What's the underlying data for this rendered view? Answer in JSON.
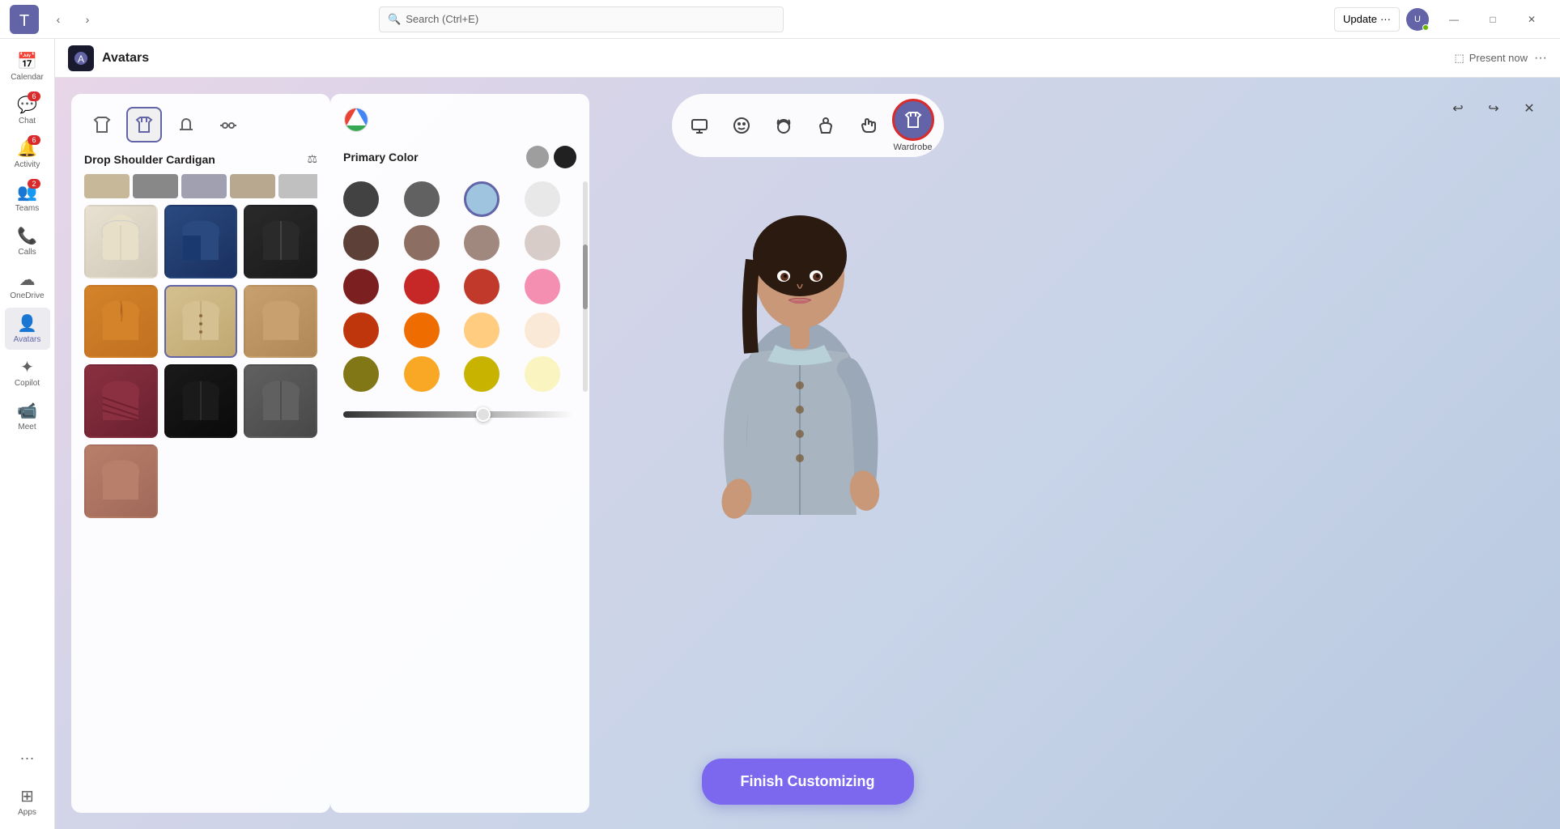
{
  "titlebar": {
    "search_placeholder": "Search (Ctrl+E)",
    "update_label": "Update",
    "update_dots": "···",
    "minimize": "—",
    "maximize": "□",
    "close": "✕"
  },
  "sidebar": {
    "items": [
      {
        "id": "calendar",
        "label": "Calendar",
        "icon": "📅",
        "badge": null
      },
      {
        "id": "chat",
        "label": "Chat",
        "icon": "💬",
        "badge": "6"
      },
      {
        "id": "activity",
        "label": "Activity",
        "icon": "🔔",
        "badge": "6"
      },
      {
        "id": "teams",
        "label": "Teams",
        "icon": "👥",
        "badge": "2"
      },
      {
        "id": "calls",
        "label": "Calls",
        "icon": "📞",
        "badge": null
      },
      {
        "id": "onedrive",
        "label": "OneDrive",
        "icon": "☁",
        "badge": null
      },
      {
        "id": "avatars",
        "label": "Avatars",
        "icon": "👤",
        "badge": null,
        "active": true
      },
      {
        "id": "copilot",
        "label": "Copilot",
        "icon": "✦",
        "badge": null
      },
      {
        "id": "meet",
        "label": "Meet",
        "icon": "📹",
        "badge": null
      },
      {
        "id": "apps",
        "label": "Apps",
        "icon": "⊞",
        "badge": null
      }
    ]
  },
  "app": {
    "title": "Avatars",
    "present_now_label": "Present now",
    "more_options": "···"
  },
  "toolbar": {
    "buttons": [
      {
        "id": "present",
        "icon": "⬜",
        "label": ""
      },
      {
        "id": "face",
        "icon": "😊",
        "label": ""
      },
      {
        "id": "hair",
        "icon": "💆",
        "label": ""
      },
      {
        "id": "body",
        "icon": "🫂",
        "label": ""
      },
      {
        "id": "gesture",
        "icon": "🤙",
        "label": ""
      },
      {
        "id": "wardrobe",
        "icon": "👕",
        "label": "Wardrobe",
        "active": true
      }
    ],
    "undo": "↩",
    "redo": "↪",
    "close": "✕"
  },
  "wardrobe": {
    "title": "Drop Shoulder Cardigan",
    "tabs": [
      {
        "id": "shirt",
        "icon": "👕"
      },
      {
        "id": "jacket",
        "icon": "🧥",
        "active": true
      },
      {
        "id": "hat",
        "icon": "🎩"
      },
      {
        "id": "glasses",
        "icon": "👓"
      }
    ],
    "items": [
      {
        "id": 1,
        "class": "ci-1",
        "selected": false
      },
      {
        "id": 2,
        "class": "ci-2",
        "selected": false
      },
      {
        "id": 3,
        "class": "ci-3",
        "selected": false
      },
      {
        "id": 4,
        "class": "ci-4",
        "selected": false
      },
      {
        "id": 5,
        "class": "ci-5",
        "selected": true
      },
      {
        "id": 6,
        "class": "ci-6",
        "selected": false
      },
      {
        "id": 7,
        "class": "ci-7",
        "selected": false
      },
      {
        "id": 8,
        "class": "ci-8",
        "selected": false
      },
      {
        "id": 9,
        "class": "ci-9",
        "selected": false
      },
      {
        "id": 10,
        "class": "ci-10",
        "selected": false
      },
      {
        "id": 11,
        "class": "ci-11",
        "selected": false
      }
    ]
  },
  "colors": {
    "panel_title": "Primary Color",
    "primary_swatches": [
      "#9e9e9e",
      "#212121"
    ],
    "swatches": [
      {
        "id": 1,
        "hex": "#424242",
        "selected": false
      },
      {
        "id": 2,
        "hex": "#616161",
        "selected": false
      },
      {
        "id": 3,
        "hex": "#9ec4e0",
        "selected": true
      },
      {
        "id": 4,
        "hex": "#e0e0e0",
        "selected": false
      },
      {
        "id": 5,
        "hex": "#5d4037",
        "selected": false
      },
      {
        "id": 6,
        "hex": "#8d6e63",
        "selected": false
      },
      {
        "id": 7,
        "hex": "#a1887f",
        "selected": false
      },
      {
        "id": 8,
        "hex": "#d7ccc8",
        "selected": false
      },
      {
        "id": 9,
        "hex": "#7b1f20",
        "selected": false
      },
      {
        "id": 10,
        "hex": "#c62828",
        "selected": false
      },
      {
        "id": 11,
        "hex": "#c0392b",
        "selected": false
      },
      {
        "id": 12,
        "hex": "#f48fb1",
        "selected": false
      },
      {
        "id": 13,
        "hex": "#bf360c",
        "selected": false
      },
      {
        "id": 14,
        "hex": "#ef6c00",
        "selected": false
      },
      {
        "id": 15,
        "hex": "#ffcc80",
        "selected": false
      },
      {
        "id": 16,
        "hex": "#fbe9d7",
        "selected": false
      },
      {
        "id": 17,
        "hex": "#827717",
        "selected": false
      },
      {
        "id": 18,
        "hex": "#f9a825",
        "selected": false
      },
      {
        "id": 19,
        "hex": "#c8b400",
        "selected": false
      },
      {
        "id": 20,
        "hex": "#f9f4c0",
        "selected": false
      }
    ],
    "slider_value": 60
  },
  "finish_button": {
    "label": "Finish Customizing"
  }
}
